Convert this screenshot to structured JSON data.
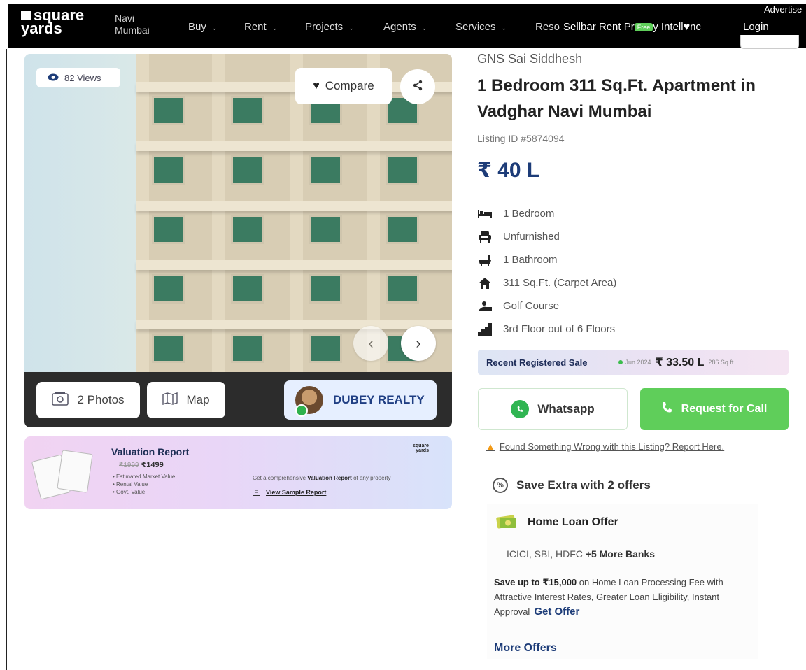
{
  "nav": {
    "logo_line1": "square",
    "logo_line2": "yards",
    "city_line1": "Navi",
    "city_line2": "Mumbai",
    "items": [
      "Buy",
      "Rent",
      "Projects",
      "Agents",
      "Services",
      "Reso"
    ],
    "sell_rent": "Sellbar Rent Pr",
    "sell_rent_badge": "Free",
    "intel": "y Intell",
    "intel_tail": "nc",
    "login": "Login",
    "advertise": "Advertise"
  },
  "gallery": {
    "views": "82 Views",
    "compare": "Compare",
    "photos": "2 Photos",
    "map": "Map",
    "agent": "DUBEY REALTY"
  },
  "valuation": {
    "title": "Valuation Report",
    "old_price": "₹1999",
    "price": "₹1499",
    "features": [
      "Estimated Market Value",
      "Rental Value",
      "Govt. Value"
    ],
    "desc_prefix": "Get a comprehensive",
    "desc_bold": "Valuation Report",
    "desc_suffix": "of any property",
    "sample_link": "View Sample Report",
    "logo_line1": "square",
    "logo_line2": "yards"
  },
  "property": {
    "project": "GNS Sai Siddhesh",
    "title": "1 Bedroom 311 Sq.Ft. Apartment in Vadghar Navi Mumbai",
    "listing_id": "Listing ID #5874094",
    "price": "₹ 40 L",
    "specs": [
      {
        "icon": "bed-icon",
        "text": "1 Bedroom"
      },
      {
        "icon": "chair-icon",
        "text": "Unfurnished"
      },
      {
        "icon": "bathtub-icon",
        "text": "1 Bathroom"
      },
      {
        "icon": "home-icon",
        "text": "311 Sq.Ft. (Carpet Area)"
      },
      {
        "icon": "golf-icon",
        "text": "Golf Course"
      },
      {
        "icon": "stairs-icon",
        "text": "3rd Floor out of 6 Floors"
      }
    ]
  },
  "recent_sale": {
    "label": "Recent Registered Sale",
    "date": "Jun 2024",
    "price": "₹ 33.50 L",
    "area": "286 Sq.ft."
  },
  "actions": {
    "whatsapp": "Whatsapp",
    "call": "Request for Call",
    "report": "Found Something Wrong with this Listing? Report Here."
  },
  "offers": {
    "heading": "Save Extra with 2 offers",
    "loan_title": "Home Loan Offer",
    "banks": "ICICI, SBI, HDFC",
    "banks_more": "+5 More Banks",
    "save_bold": "Save up to ₹15,000",
    "save_rest": "on Home Loan Processing Fee with Attractive Interest Rates, Greater Loan Eligibility, Instant Approval",
    "get_offer": "Get Offer",
    "more": "More Offers"
  },
  "colors": {
    "nav_bg": "#000000",
    "brand_blue": "#1d3c78",
    "call_green": "#5fce5a",
    "whatsapp_green": "#30b552"
  }
}
